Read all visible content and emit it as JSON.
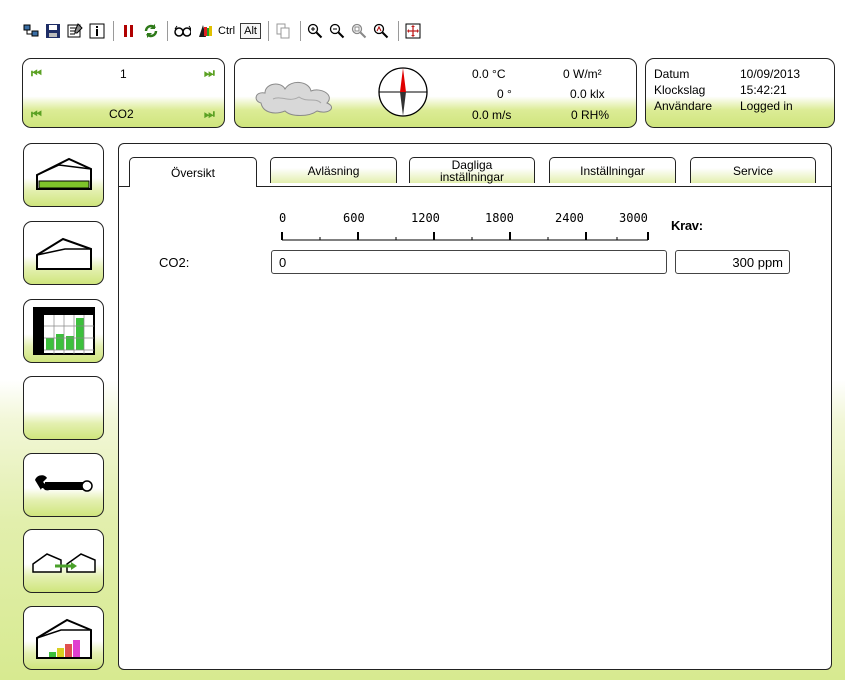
{
  "toolbar": {
    "icons": [
      "network-icon",
      "save-icon",
      "properties-icon",
      "info-icon",
      "pause-icon",
      "refresh-icon",
      "glasses-icon",
      "palette-icon",
      "copy-icon",
      "zoom-in-icon",
      "zoom-out-icon",
      "zoom-fit-icon",
      "zoom-custom-icon",
      "fullscreen-icon"
    ],
    "ctrl_label": "Ctrl",
    "alt_label": "Alt"
  },
  "nav": {
    "number": "1",
    "sensor": "CO2"
  },
  "weather": {
    "temperature": "0.0 °C",
    "radiation": "0 W/m²",
    "direction": "0 °",
    "light": "0.0 klx",
    "wind_speed": "0.0 m/s",
    "humidity": "0 RH%"
  },
  "info": {
    "date_label": "Datum",
    "date_value": "10/09/2013",
    "time_label": "Klockslag",
    "time_value": "15:42:21",
    "user_label": "Användare",
    "user_value": "Logged in"
  },
  "sidebar": {
    "items": [
      "greenhouse-overview",
      "greenhouse",
      "climate-table",
      "blank",
      "service",
      "greenhouse-compare",
      "greenhouse-graph"
    ]
  },
  "tabs": [
    {
      "label": "Översikt",
      "active": true
    },
    {
      "label": "Avläsning",
      "active": false
    },
    {
      "label": "Dagliga\ninställningar",
      "active": false
    },
    {
      "label": "Inställningar",
      "active": false
    },
    {
      "label": "Service",
      "active": false
    }
  ],
  "scale": {
    "ticks": [
      "0",
      "600",
      "1200",
      "1800",
      "2400",
      "3000"
    ],
    "requirement_header": "Krav:"
  },
  "co2": {
    "label": "CO2:",
    "value": "0",
    "requirement": "300 ppm",
    "bar_fraction": 0
  }
}
